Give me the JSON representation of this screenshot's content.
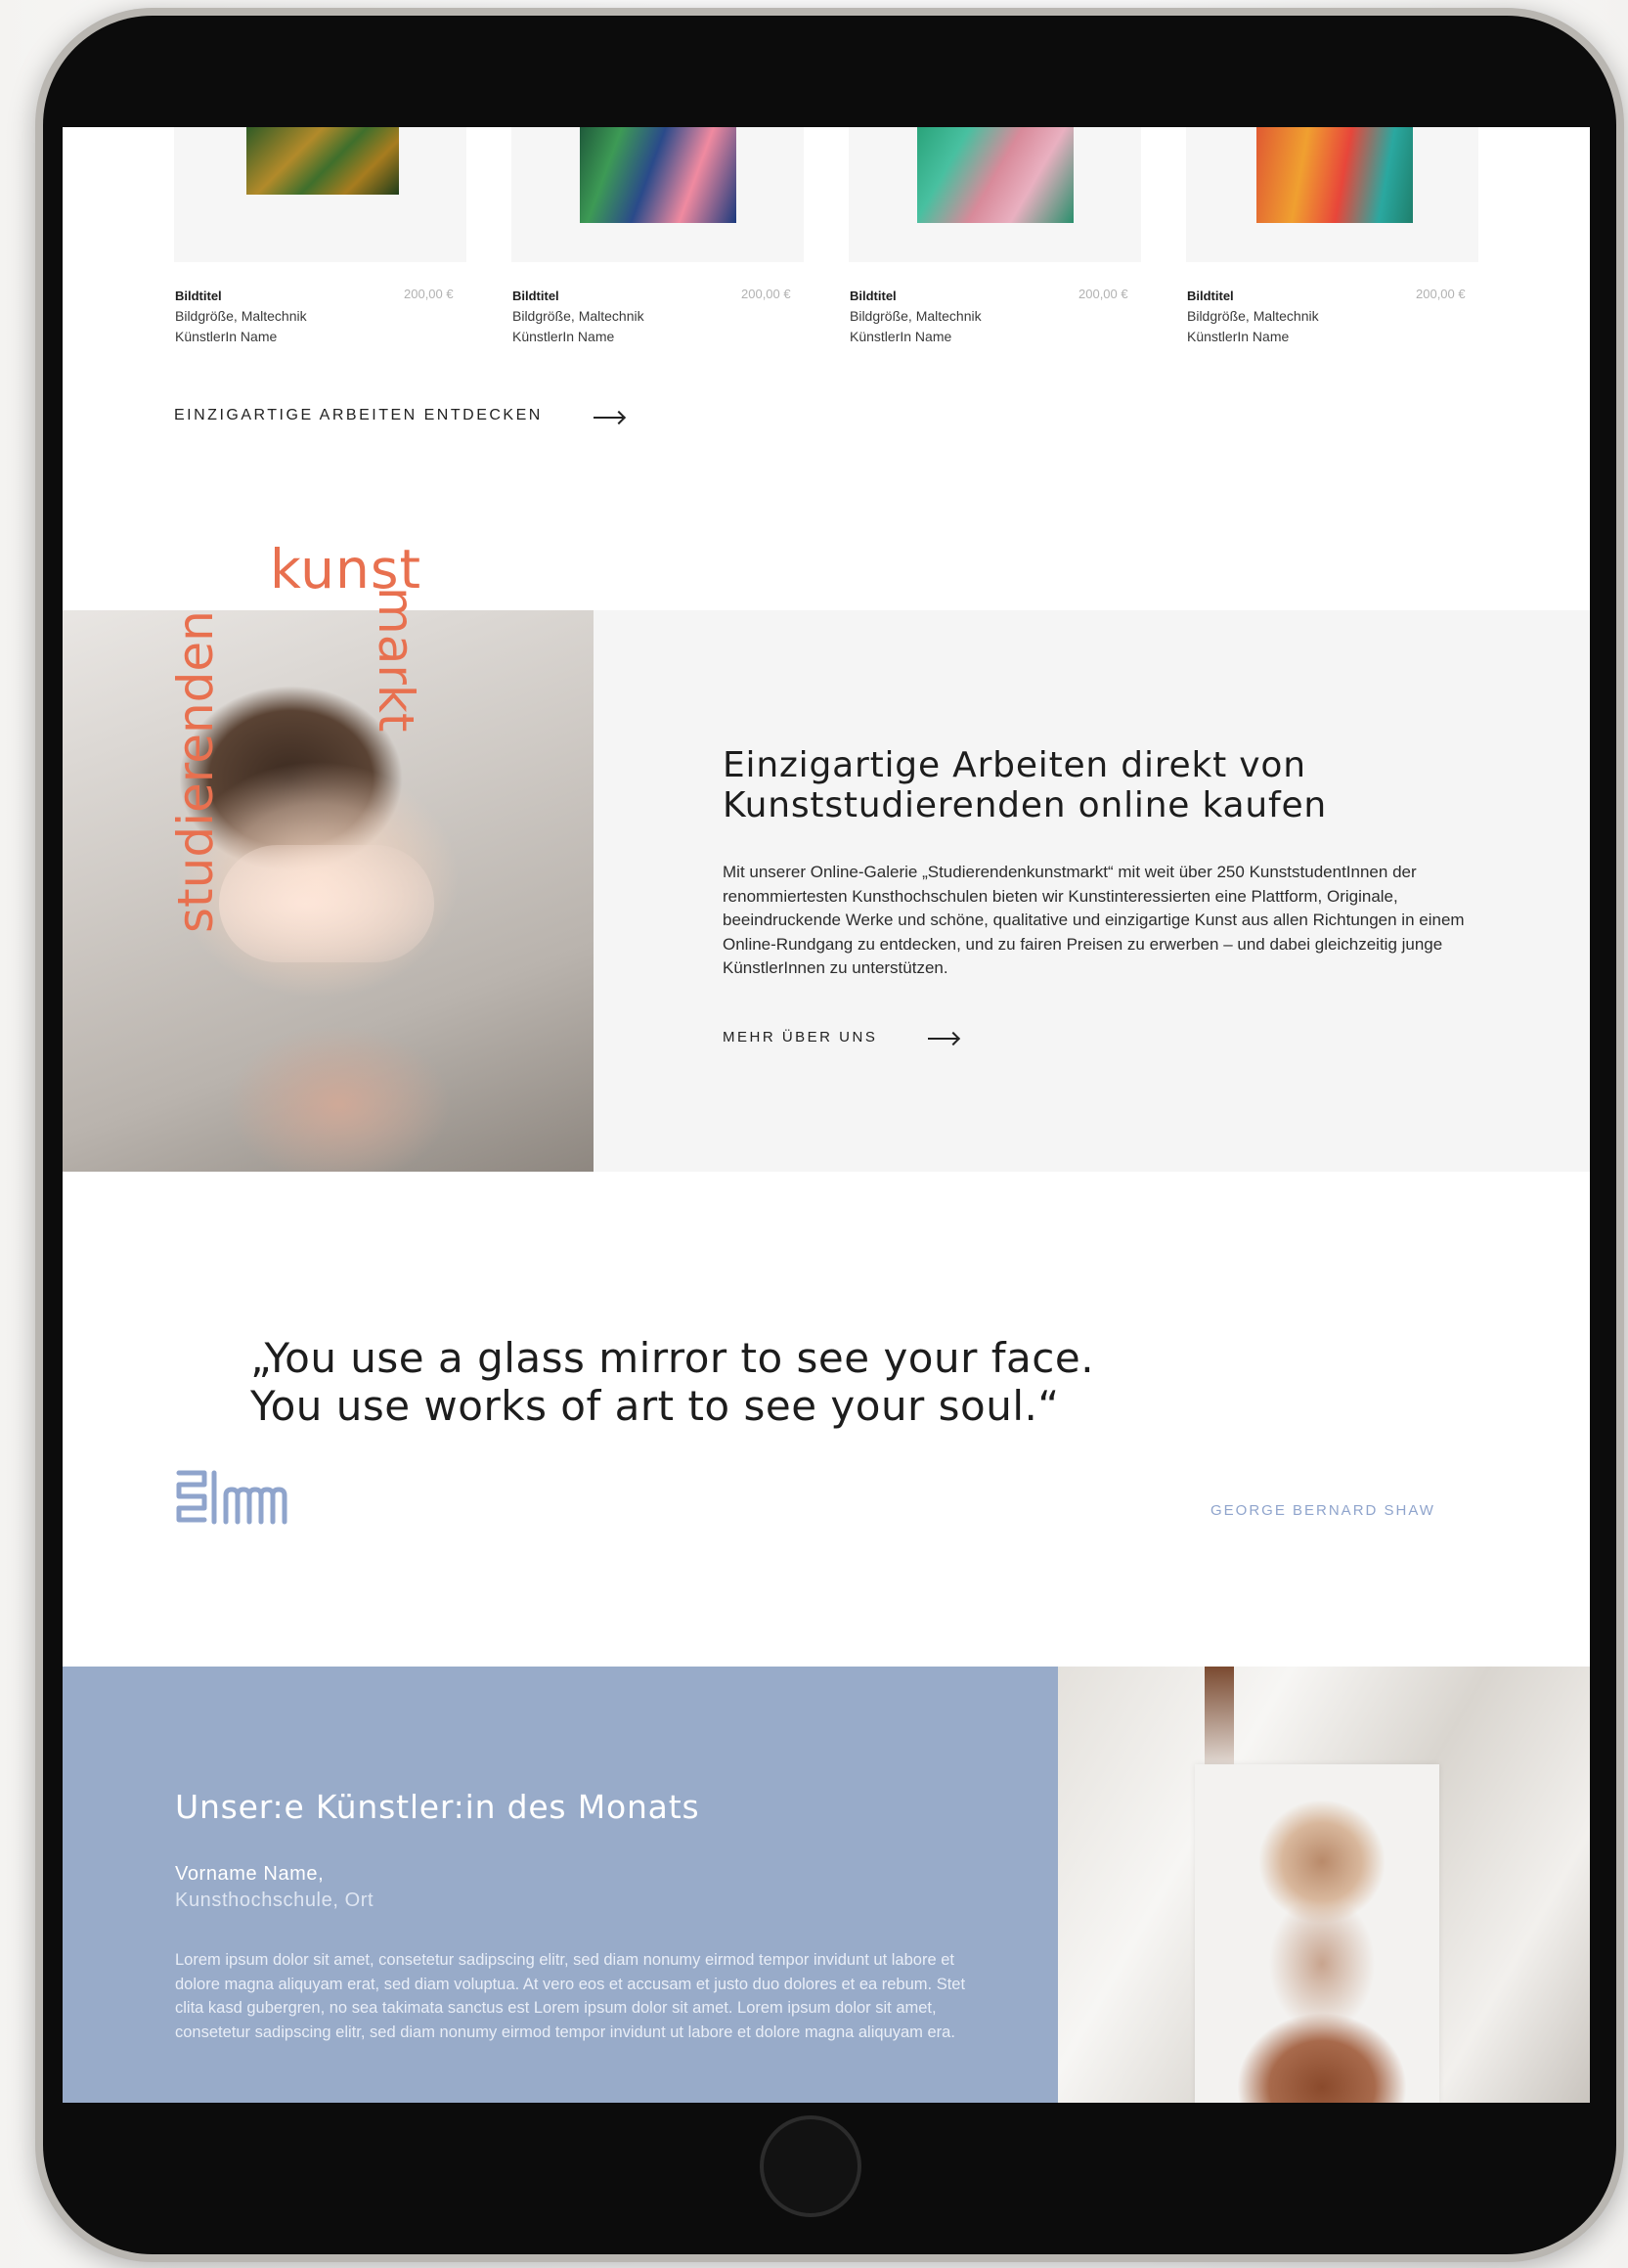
{
  "products": [
    {
      "title": "Bildtitel",
      "price": "200,00 €",
      "size_technique": "Bildgröße, Maltechnik",
      "artist": "KünstlerIn Name"
    },
    {
      "title": "Bildtitel",
      "price": "200,00 €",
      "size_technique": "Bildgröße, Maltechnik",
      "artist": "KünstlerIn Name"
    },
    {
      "title": "Bildtitel",
      "price": "200,00 €",
      "size_technique": "Bildgröße, Maltechnik",
      "artist": "KünstlerIn Name"
    },
    {
      "title": "Bildtitel",
      "price": "200,00 €",
      "size_technique": "Bildgröße, Maltechnik",
      "artist": "KünstlerIn Name"
    }
  ],
  "discover_cta": "EINZIGARTIGE ARBEITEN ENTDECKEN",
  "brand": {
    "word1": "kunst",
    "word2": "markt",
    "word3": "studierenden"
  },
  "about": {
    "title_line1": "Einzigartige Arbeiten direkt von",
    "title_line2": "Kunststudierenden online kaufen",
    "body": "Mit unserer Online-Galerie „Studierendenkunstmarkt“ mit weit über 250 KunststudentInnen der renommiertesten Kunsthochschulen bieten wir Kunstinteressierten eine Plattform, Originale, beeindruckende Werke und schöne, qualitative und einzigartige Kunst aus allen Richtungen in einem Online-Rundgang zu entdecken, und zu fairen Preisen zu erwerben – und dabei gleichzeitig junge KünstlerInnen zu unterstützen.",
    "cta": "MEHR ÜBER UNS"
  },
  "quote": {
    "line1": "„You use a glass mirror to see your face.",
    "line2": "You use works of art to see your soul.“",
    "author": "GEORGE BERNARD SHAW"
  },
  "artist_of_month": {
    "title": "Unser:e Künstler:in des Monats",
    "name": "Vorname Name,",
    "school": "Kunsthochschule, Ort",
    "body": "Lorem ipsum dolor sit amet, consetetur sadipscing elitr, sed diam nonumy eirmod tempor invidunt ut labore et dolore magna aliquyam erat, sed diam voluptua. At vero eos et accusam et justo duo dolores et ea rebum. Stet clita kasd gubergren, no sea takimata sanctus est Lorem ipsum dolor sit amet. Lorem ipsum dolor sit amet, consetetur sadipscing elitr, sed diam nonumy eirmod tempor invidunt ut labore et dolore magna aliquyam era."
  },
  "colors": {
    "accent": "#e8704f",
    "blue": "#98abc9",
    "author": "#8fa4cc"
  },
  "icons": [
    "arrow-right-icon",
    "studierendenkunstmarkt-logo"
  ]
}
